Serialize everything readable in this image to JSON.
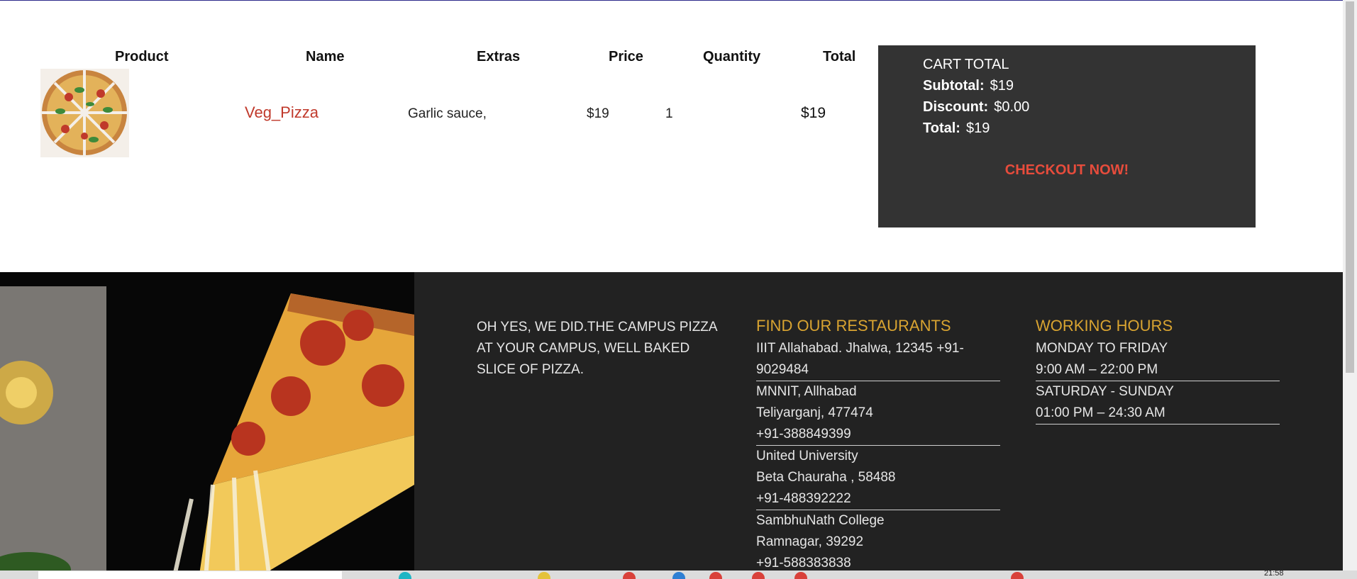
{
  "table": {
    "headers": [
      "Product",
      "Name",
      "Extras",
      "Price",
      "Quantity",
      "Total"
    ],
    "rows": [
      {
        "name": "Veg_Pizza",
        "extras": "Garlic sauce,",
        "price": "$19",
        "quantity": "1",
        "total": "$19"
      }
    ]
  },
  "cart_total": {
    "title": "CART TOTAL",
    "subtotal_label": "Subtotal:",
    "subtotal_value": "$19",
    "discount_label": "Discount:",
    "discount_value": "$0.00",
    "total_label": "Total:",
    "total_value": "$19",
    "checkout_label": "CHECKOUT NOW!"
  },
  "footer": {
    "tagline": "OH YES, WE DID.THE CAMPUS PIZZA AT YOUR CAMPUS, WELL BAKED SLICE OF PIZZA.",
    "restaurants_title": "FIND OUR RESTAURANTS",
    "restaurants": [
      {
        "lines": [
          "IIIT Allahabad. Jhalwa, 12345 +91-9029484"
        ]
      },
      {
        "lines": [
          "MNNIT, Allhabad",
          "Teliyarganj, 477474",
          "+91-388849399"
        ]
      },
      {
        "lines": [
          "United University",
          "Beta Chauraha , 58488",
          "+91-488392222"
        ]
      },
      {
        "lines": [
          "SambhuNath College",
          "Ramnagar, 39292",
          "+91-588383838"
        ]
      }
    ],
    "hours_title": "WORKING HOURS",
    "hours": [
      {
        "lines": [
          "MONDAY TO FRIDAY",
          "9:00 AM – 22:00 PM"
        ]
      },
      {
        "lines": [
          "SATURDAY - SUNDAY",
          "01:00 PM – 24:30 AM"
        ]
      }
    ]
  },
  "taskbar": {
    "clock": "21:58"
  },
  "colors": {
    "accent": "#c0392b",
    "checkout": "#e74c3c",
    "footer_heading": "#d9a431",
    "footer_bg": "#222222",
    "cart_total_bg": "#333333"
  }
}
